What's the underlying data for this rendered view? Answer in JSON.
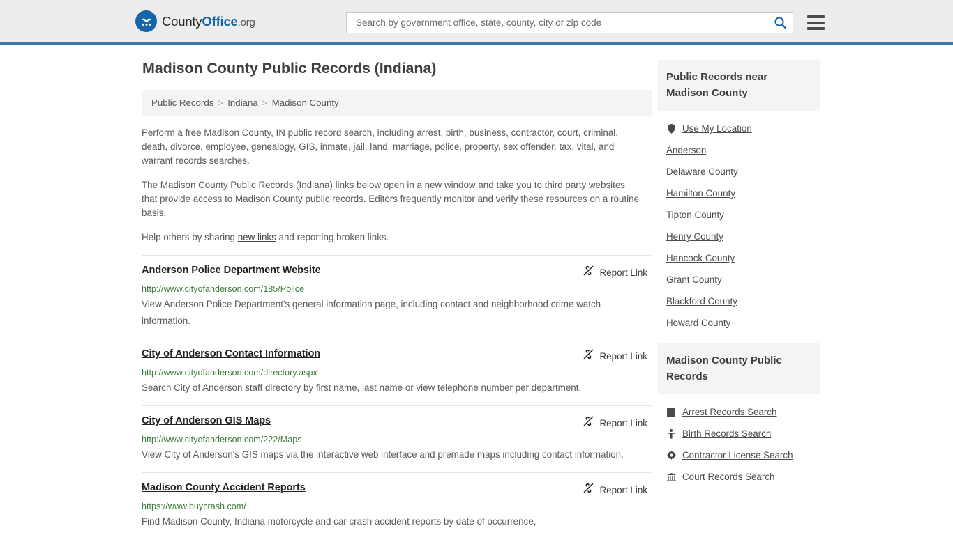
{
  "header": {
    "logo_text_1": "County",
    "logo_text_2": "Office",
    "logo_text_3": ".org",
    "logo_icon": "eagle-stars-seal-icon",
    "search": {
      "placeholder": "Search by government office, state, county, city or zip code",
      "value": "",
      "icon": "search-icon"
    },
    "menu_icon": "hamburger-menu-icon",
    "accent_color": "#3a79b0"
  },
  "page_title": "Madison County Public Records (Indiana)",
  "breadcrumb": {
    "items": [
      "Public Records",
      "Indiana",
      "Madison County"
    ],
    "separator": ">"
  },
  "intro": {
    "paragraph_1": "Perform a free Madison County, IN public record search, including arrest, birth, business, contractor, court, criminal, death, divorce, employee, genealogy, GIS, inmate, jail, land, marriage, police, property, sex offender, tax, vital, and warrant records searches.",
    "paragraph_2": "The Madison County Public Records (Indiana) links below open in a new window and take you to third party websites that provide access to Madison County public records. Editors frequently monitor and verify these resources on a routine basis.",
    "help_prefix": "Help others by sharing ",
    "help_link": "new links",
    "help_suffix": " and reporting broken links."
  },
  "report_link_label": "Report Link",
  "report_link_icon": "broken-chain-icon",
  "results": [
    {
      "title": "Anderson Police Department Website",
      "url": "http://www.cityofanderson.com/185/Police",
      "description": "View Anderson Police Department's general information page, including contact and neighborhood crime watch information."
    },
    {
      "title": "City of Anderson Contact Information",
      "url": "http://www.cityofanderson.com/directory.aspx",
      "description": "Search City of Anderson staff directory by first name, last name or view telephone number per department."
    },
    {
      "title": "City of Anderson GIS Maps",
      "url": "http://www.cityofanderson.com/222/Maps",
      "description": "View City of Anderson's GIS maps via the interactive web interface and premade maps including contact information."
    },
    {
      "title": "Madison County Accident Reports",
      "url": "https://www.buycrash.com/",
      "description": "Find Madison County, Indiana motorcycle and car crash accident reports by date of occurrence,"
    }
  ],
  "sidebar": {
    "nearby_panel": {
      "title": "Public Records near Madison County",
      "items": [
        {
          "label": "Use My Location",
          "icon": "map-pin-icon"
        },
        {
          "label": "Anderson",
          "icon": ""
        },
        {
          "label": "Delaware County",
          "icon": ""
        },
        {
          "label": "Hamilton County",
          "icon": ""
        },
        {
          "label": "Tipton County",
          "icon": ""
        },
        {
          "label": "Henry County",
          "icon": ""
        },
        {
          "label": "Hancock County",
          "icon": ""
        },
        {
          "label": "Grant County",
          "icon": ""
        },
        {
          "label": "Blackford County",
          "icon": ""
        },
        {
          "label": "Howard County",
          "icon": ""
        }
      ]
    },
    "records_panel": {
      "title": "Madison County Public Records",
      "items": [
        {
          "label": "Arrest Records Search",
          "icon": "fingerprint-square-icon"
        },
        {
          "label": "Birth Records Search",
          "icon": "baby-icon"
        },
        {
          "label": "Contractor License Search",
          "icon": "gear-icon"
        },
        {
          "label": "Court Records Search",
          "icon": "courthouse-icon"
        }
      ]
    }
  }
}
